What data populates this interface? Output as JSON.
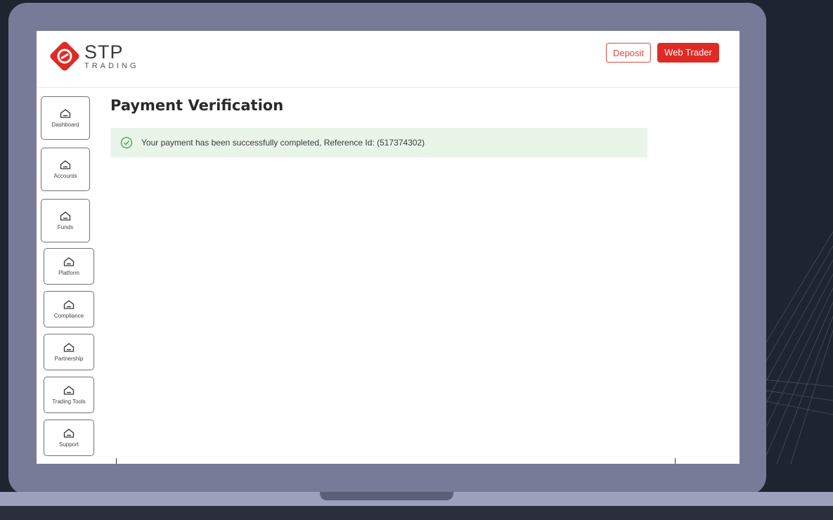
{
  "brand": {
    "name": "STP",
    "sub": "TRADING"
  },
  "header": {
    "deposit_label": "Deposit",
    "web_trader_label": "Web Trader"
  },
  "sidebar": {
    "items": [
      {
        "label": "Dashboard",
        "icon": "home-icon"
      },
      {
        "label": "Accounts",
        "icon": "home-icon"
      },
      {
        "label": "Funds",
        "icon": "home-icon"
      },
      {
        "label": "Platform",
        "icon": "home-icon"
      },
      {
        "label": "Compliance",
        "icon": "home-icon"
      },
      {
        "label": "Partnership",
        "icon": "home-icon"
      },
      {
        "label": "Trading Tools",
        "icon": "home-icon"
      },
      {
        "label": "Support",
        "icon": "home-icon"
      }
    ]
  },
  "main": {
    "title": "Payment Verification",
    "alert_text": "Your payment has been successfully completed, Reference Id: (517374302)"
  },
  "colors": {
    "accent": "#df2b25",
    "success_bg": "#eaf5ea",
    "success_icon": "#3fa34d"
  }
}
